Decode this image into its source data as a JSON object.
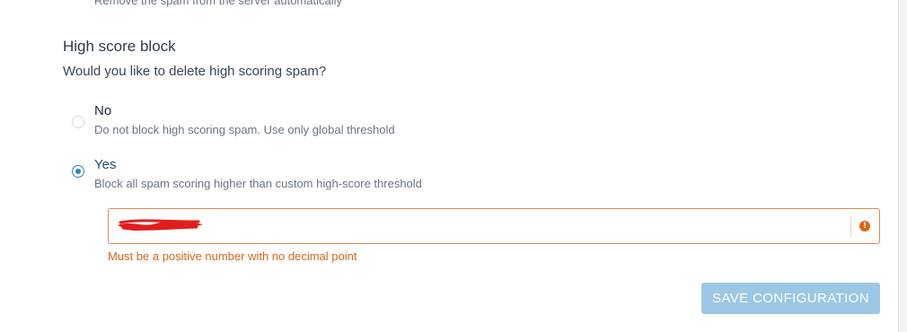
{
  "previous_option": {
    "description": "Remove the spam from the server automatically"
  },
  "high_score_block": {
    "title": "High score block",
    "question": "Would you like to delete high scoring spam?",
    "options": [
      {
        "label": "No",
        "description": "Do not block high scoring spam. Use only global threshold",
        "selected": false
      },
      {
        "label": "Yes",
        "description": "Block all spam scoring higher than custom high-score threshold",
        "selected": true
      }
    ],
    "threshold_error": "Must be a positive number with no decimal point"
  },
  "actions": {
    "save_label": "SAVE CONFIGURATION"
  },
  "colors": {
    "accent": "#2a83c6",
    "error": "#d4661b",
    "error_border": "#d98a4b",
    "button_disabled": "#9cc7e4",
    "redaction": "#e01e1e"
  },
  "icons": {
    "error": "exclamation-circle-icon"
  }
}
